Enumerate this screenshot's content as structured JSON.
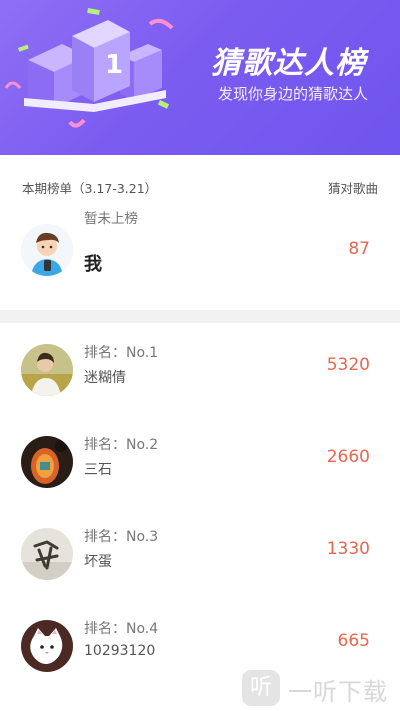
{
  "banner": {
    "title": "猜歌达人榜",
    "subtitle": "发现你身边的猜歌达人",
    "podium_number": "1"
  },
  "section": {
    "period_label": "本期榜单（3.17-3.21）",
    "score_label": "猜对歌曲"
  },
  "my_entry": {
    "status": "暂未上榜",
    "name": "我",
    "score": "87",
    "avatar_icon": "boy-with-phone-avatar"
  },
  "leaderboard": [
    {
      "rank": "排名：No.1",
      "name": "迷糊倩",
      "score": "5320"
    },
    {
      "rank": "排名：No.2",
      "name": "三石",
      "score": "2660"
    },
    {
      "rank": "排名：No.3",
      "name": "坏蛋",
      "score": "1330"
    },
    {
      "rank": "排名：No.4",
      "name": "10293120",
      "score": "665"
    }
  ],
  "watermark": {
    "text": "一听下载",
    "icon_char": "听"
  },
  "colors": {
    "banner": "#7b5cf0",
    "score": "#e7674f",
    "divider": "#f2f2f2"
  }
}
